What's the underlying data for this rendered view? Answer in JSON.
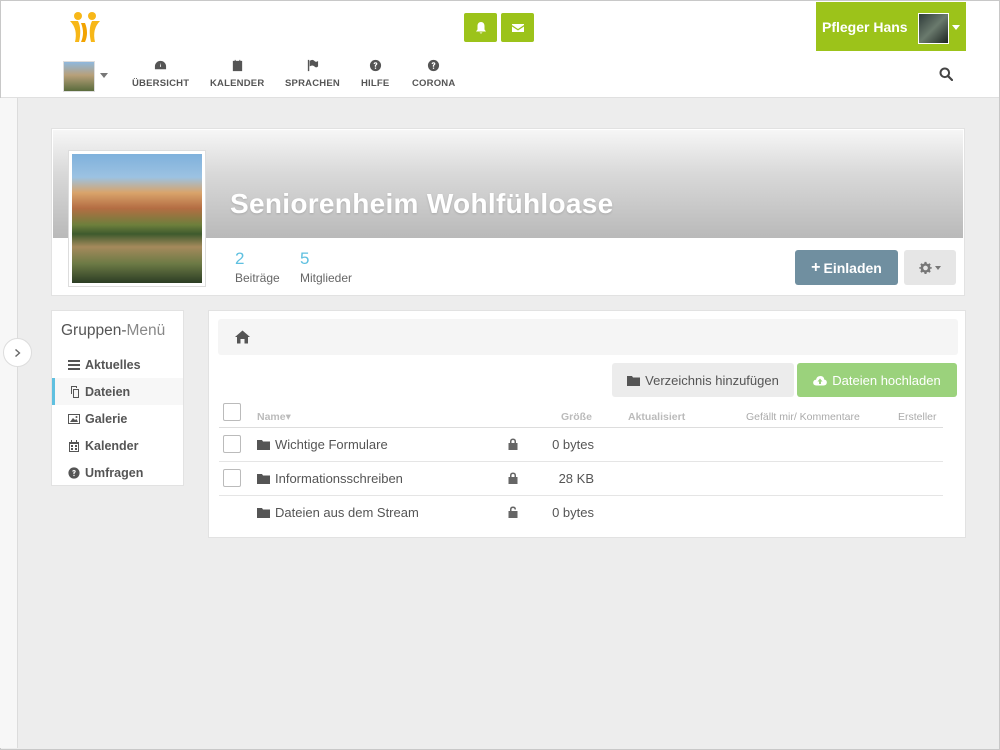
{
  "header": {
    "user_name": "Pfleger Hans"
  },
  "nav": {
    "items": [
      {
        "label": "ÜBERSICHT"
      },
      {
        "label": "KALENDER"
      },
      {
        "label": "SPRACHEN"
      },
      {
        "label": "HILFE"
      },
      {
        "label": "CORONA"
      }
    ]
  },
  "space": {
    "title": "Seniorenheim Wohlfühloase",
    "stats": [
      {
        "value": "2",
        "label": "Beiträge"
      },
      {
        "value": "5",
        "label": "Mitglieder"
      }
    ],
    "invite_label": "Einladen"
  },
  "group_menu": {
    "title_main": "Gruppen-",
    "title_light": "Menü",
    "items": [
      {
        "label": "Aktuelles"
      },
      {
        "label": "Dateien"
      },
      {
        "label": "Galerie"
      },
      {
        "label": "Kalender"
      },
      {
        "label": "Umfragen"
      }
    ]
  },
  "files": {
    "add_dir_label": "Verzeichnis hinzufügen",
    "upload_label": "Dateien hochladen",
    "columns": {
      "name": "Name",
      "size": "Größe",
      "updated": "Aktualisiert",
      "likes": "Gefällt mir/ Kommentare",
      "creator": "Ersteller"
    },
    "rows": [
      {
        "name": "Wichtige Formulare",
        "size": "0 bytes"
      },
      {
        "name": "Informationsschreiben",
        "size": "28 KB"
      },
      {
        "name": "Dateien aus dem Stream",
        "size": "0 bytes"
      }
    ]
  },
  "colors": {
    "brand_green": "#9cc31a",
    "accent_blue": "#5fc0e0",
    "invite_blue": "#708fa0",
    "upload_green": "#9bd27c"
  }
}
